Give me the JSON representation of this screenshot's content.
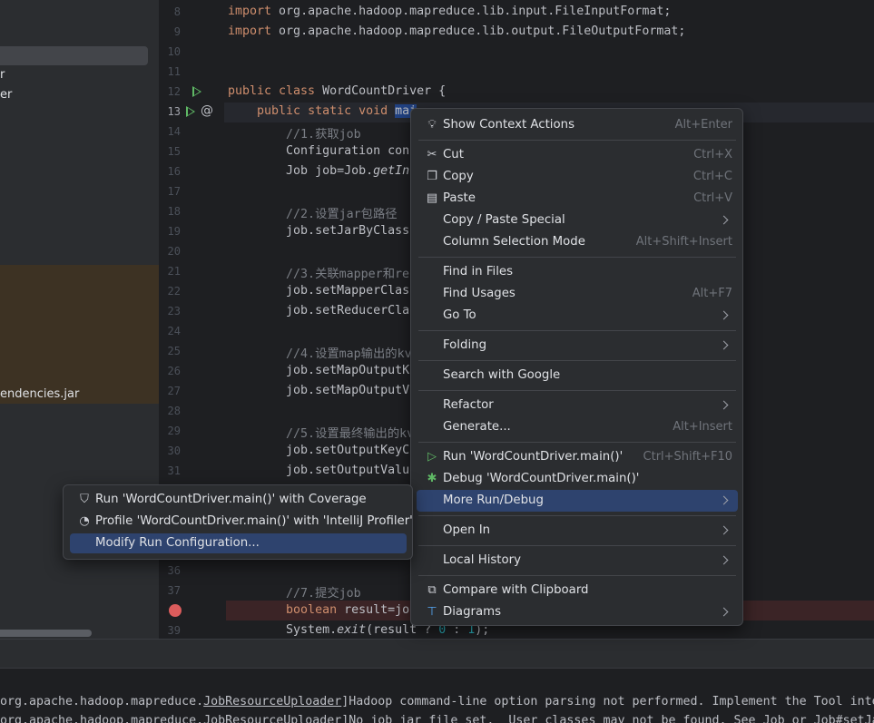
{
  "sidebar": {
    "frag_1": "r",
    "frag_2": "er",
    "frag_3": "endencies.jar"
  },
  "editor": {
    "lines": [
      {
        "n": "8",
        "parts": [
          [
            "kw",
            "import "
          ],
          [
            "",
            "org.apache.hadoop.mapreduce.lib.input.FileInputFormat;"
          ]
        ]
      },
      {
        "n": "9",
        "parts": [
          [
            "kw",
            "import "
          ],
          [
            "",
            "org.apache.hadoop.mapreduce.lib.output.FileOutputFormat;"
          ]
        ]
      },
      {
        "n": "10",
        "parts": []
      },
      {
        "n": "11",
        "parts": []
      },
      {
        "n": "12",
        "parts": [
          [
            "kw",
            "public class "
          ],
          [
            "",
            "WordCountDriver {"
          ]
        ]
      },
      {
        "n": "13",
        "parts": [
          [
            "",
            "    "
          ],
          [
            "kw",
            "public static void "
          ],
          [
            "hl-sel",
            "mai"
          ]
        ]
      },
      {
        "n": "14",
        "parts": [
          [
            "cm",
            "        //1.获取job"
          ]
        ]
      },
      {
        "n": "15",
        "parts": [
          [
            "",
            "        Configuration con"
          ]
        ]
      },
      {
        "n": "16",
        "parts": [
          [
            "",
            "        Job job=Job."
          ],
          [
            "it",
            "getIn"
          ]
        ]
      },
      {
        "n": "17",
        "parts": []
      },
      {
        "n": "18",
        "parts": [
          [
            "cm",
            "        //2.设置jar包路径"
          ]
        ]
      },
      {
        "n": "19",
        "parts": [
          [
            "",
            "        job.setJarByClass"
          ]
        ]
      },
      {
        "n": "20",
        "parts": []
      },
      {
        "n": "21",
        "parts": [
          [
            "cm",
            "        //3.关联mapper和re"
          ]
        ]
      },
      {
        "n": "22",
        "parts": [
          [
            "",
            "        job.setMapperClas"
          ]
        ]
      },
      {
        "n": "23",
        "parts": [
          [
            "",
            "        job.setReducerCla"
          ]
        ]
      },
      {
        "n": "24",
        "parts": []
      },
      {
        "n": "25",
        "parts": [
          [
            "cm",
            "        //4.设置map输出的kv"
          ]
        ]
      },
      {
        "n": "26",
        "parts": [
          [
            "",
            "        job.setMapOutputK"
          ]
        ]
      },
      {
        "n": "27",
        "parts": [
          [
            "",
            "        job.setMapOutputV"
          ]
        ]
      },
      {
        "n": "28",
        "parts": []
      },
      {
        "n": "29",
        "parts": [
          [
            "cm",
            "        //5.设置最终输出的kv"
          ]
        ]
      },
      {
        "n": "30",
        "parts": [
          [
            "",
            "        job.setOutputKeyC"
          ]
        ]
      },
      {
        "n": "31",
        "parts": [
          [
            "",
            "        job.setOutputValu"
          ]
        ]
      },
      {
        "n": "36",
        "parts": []
      },
      {
        "n": "37",
        "parts": [
          [
            "cm",
            "        //7.提交job"
          ]
        ]
      },
      {
        "n": "",
        "parts": [
          [
            "kw",
            "        boolean "
          ],
          [
            "",
            "result=jo"
          ]
        ]
      },
      {
        "n": "39",
        "parts": [
          [
            "",
            "        System."
          ],
          [
            "it",
            "exit"
          ],
          [
            "",
            "(result ? "
          ],
          [
            "num",
            "0"
          ],
          [
            "",
            " : "
          ],
          [
            "num",
            "1"
          ],
          [
            "",
            ");"
          ]
        ]
      }
    ]
  },
  "context_menu": {
    "show_context_actions": "Show Context Actions",
    "show_context_actions_sc": "Alt+Enter",
    "cut": "Cut",
    "cut_sc": "Ctrl+X",
    "copy": "Copy",
    "copy_sc": "Ctrl+C",
    "paste": "Paste",
    "paste_sc": "Ctrl+V",
    "copy_paste_special": "Copy / Paste Special",
    "column_selection_mode": "Column Selection Mode",
    "column_selection_mode_sc": "Alt+Shift+Insert",
    "find_in_files": "Find in Files",
    "find_usages": "Find Usages",
    "find_usages_sc": "Alt+F7",
    "go_to": "Go To",
    "folding": "Folding",
    "search_with_google": "Search with Google",
    "refactor": "Refactor",
    "generate": "Generate...",
    "generate_sc": "Alt+Insert",
    "run": "Run 'WordCountDriver.main()'",
    "run_sc": "Ctrl+Shift+F10",
    "debug": "Debug 'WordCountDriver.main()'",
    "more_run_debug": "More Run/Debug",
    "open_in": "Open In",
    "local_history": "Local History",
    "compare_with_clipboard": "Compare with Clipboard",
    "diagrams": "Diagrams"
  },
  "submenu": {
    "run_with_coverage": "Run 'WordCountDriver.main()' with Coverage",
    "profile": "Profile 'WordCountDriver.main()' with 'IntelliJ Profiler'",
    "modify_run_configuration": "Modify Run Configuration..."
  },
  "console": {
    "line1_a": "org.apache.hadoop.mapreduce.",
    "line1_b": "JobResourceUploader",
    "line1_c": "]Hadoop command-line option parsing not performed. Implement the Tool inte",
    "line2": "org.apache.hadoop.mapreduce.JobResourceUploader]No job jar file set.  User classes may not be found. See Job or Job#setJa"
  },
  "colors": {
    "accent_selection": "#2e436e",
    "keyword": "#cf8e6d",
    "comment": "#7a7e85",
    "breakpoint": "#db5c5c",
    "run_gutter": "#5fb865"
  }
}
